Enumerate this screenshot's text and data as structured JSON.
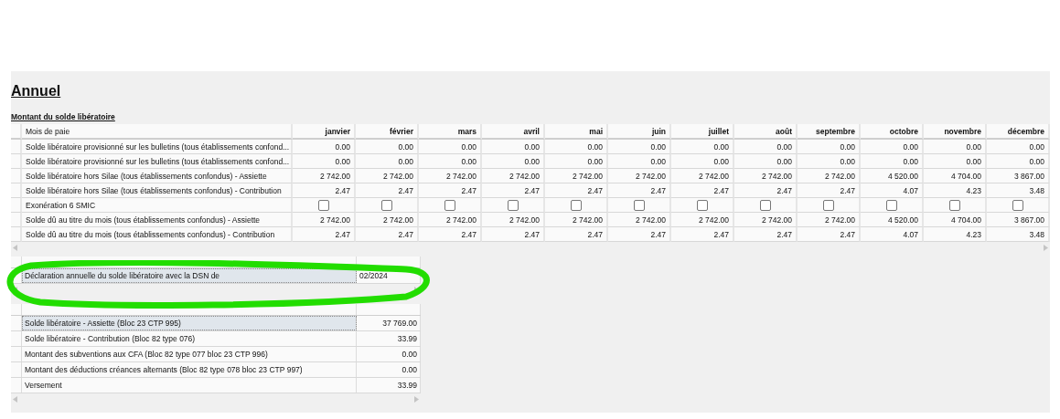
{
  "title": "Annuel",
  "section_title": "Montant du solde libératoire",
  "table": {
    "columns": [
      "Mois de paie",
      "janvier",
      "février",
      "mars",
      "avril",
      "mai",
      "juin",
      "juillet",
      "août",
      "septembre",
      "octobre",
      "novembre",
      "décembre"
    ],
    "rows": [
      {
        "kind": "values",
        "label": "Solde libératoire provisionné sur les bulletins (tous établissements confond...",
        "values": [
          "0.00",
          "0.00",
          "0.00",
          "0.00",
          "0.00",
          "0.00",
          "0.00",
          "0.00",
          "0.00",
          "0.00",
          "0.00",
          "0.00"
        ]
      },
      {
        "kind": "values",
        "label": "Solde libératoire provisionné sur les bulletins (tous établissements confond...",
        "values": [
          "0.00",
          "0.00",
          "0.00",
          "0.00",
          "0.00",
          "0.00",
          "0.00",
          "0.00",
          "0.00",
          "0.00",
          "0.00",
          "0.00"
        ]
      },
      {
        "kind": "values",
        "label": "Solde libératoire hors Silae (tous établissements confondus) - Assiette",
        "values": [
          "2 742.00",
          "2 742.00",
          "2 742.00",
          "2 742.00",
          "2 742.00",
          "2 742.00",
          "2 742.00",
          "2 742.00",
          "2 742.00",
          "4 520.00",
          "4 704.00",
          "3 867.00"
        ]
      },
      {
        "kind": "values",
        "label": "Solde libératoire hors Silae (tous établissements confondus) - Contribution",
        "values": [
          "2.47",
          "2.47",
          "2.47",
          "2.47",
          "2.47",
          "2.47",
          "2.47",
          "2.47",
          "2.47",
          "4.07",
          "4.23",
          "3.48"
        ]
      },
      {
        "kind": "checkbox",
        "label": "Exonération 6 SMIC",
        "checked": [
          false,
          false,
          false,
          false,
          false,
          false,
          false,
          false,
          false,
          false,
          false,
          false
        ]
      },
      {
        "kind": "values",
        "label": "Solde dû au titre du mois (tous établissements confondus) - Assiette",
        "values": [
          "2 742.00",
          "2 742.00",
          "2 742.00",
          "2 742.00",
          "2 742.00",
          "2 742.00",
          "2 742.00",
          "2 742.00",
          "2 742.00",
          "4 520.00",
          "4 704.00",
          "3 867.00"
        ]
      },
      {
        "kind": "values",
        "label": "Solde dû au titre du mois (tous établissements confondus) - Contribution",
        "values": [
          "2.47",
          "2.47",
          "2.47",
          "2.47",
          "2.47",
          "2.47",
          "2.47",
          "2.47",
          "2.47",
          "4.07",
          "4.23",
          "3.48"
        ]
      }
    ]
  },
  "declaration": {
    "label": "Déclaration annuelle du solde libératoire avec la DSN de",
    "value": "02/2024",
    "selected": true
  },
  "summary": [
    {
      "label": "Solde libératoire - Assiette (Bloc 23 CTP 995)",
      "value": "37 769.00",
      "selected": true
    },
    {
      "label": "Solde libératoire - Contribution (Bloc 82 type 076)",
      "value": "33.99",
      "selected": false
    },
    {
      "label": "Montant des subventions aux CFA (Bloc 82 type 077 bloc 23 CTP 996)",
      "value": "0.00",
      "selected": false
    },
    {
      "label": "Montant des déductions créances alternants (Bloc 82 type 078 bloc 23 CTP 997)",
      "value": "0.00",
      "selected": false
    },
    {
      "label": "Versement",
      "value": "33.99",
      "selected": false
    }
  ]
}
